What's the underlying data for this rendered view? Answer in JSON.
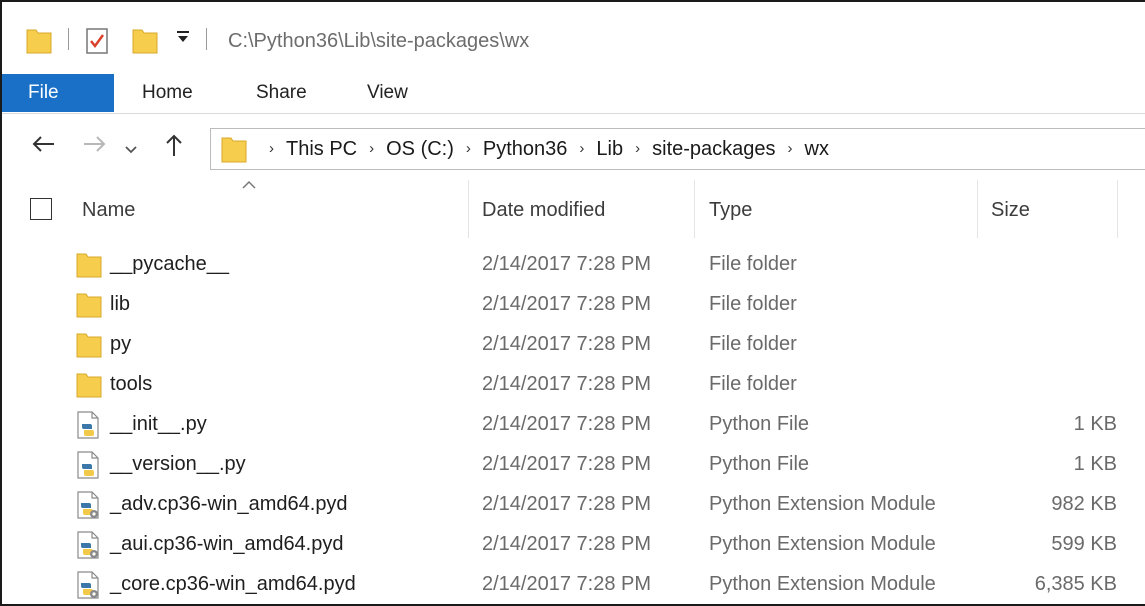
{
  "window": {
    "title_path": "C:\\Python36\\Lib\\site-packages\\wx"
  },
  "ribbon": {
    "tabs": [
      {
        "label": "File",
        "active": true
      },
      {
        "label": "Home",
        "active": false
      },
      {
        "label": "Share",
        "active": false
      },
      {
        "label": "View",
        "active": false
      }
    ]
  },
  "address_bar": {
    "breadcrumbs": [
      "This PC",
      "OS (C:)",
      "Python36",
      "Lib",
      "site-packages",
      "wx"
    ]
  },
  "columns": {
    "name": "Name",
    "date": "Date modified",
    "type": "Type",
    "size": "Size"
  },
  "files": [
    {
      "name": "__pycache__",
      "date": "2/14/2017 7:28 PM",
      "type": "File folder",
      "size": "",
      "icon": "folder-icon"
    },
    {
      "name": "lib",
      "date": "2/14/2017 7:28 PM",
      "type": "File folder",
      "size": "",
      "icon": "folder-icon"
    },
    {
      "name": "py",
      "date": "2/14/2017 7:28 PM",
      "type": "File folder",
      "size": "",
      "icon": "folder-icon"
    },
    {
      "name": "tools",
      "date": "2/14/2017 7:28 PM",
      "type": "File folder",
      "size": "",
      "icon": "folder-icon"
    },
    {
      "name": "__init__.py",
      "date": "2/14/2017 7:28 PM",
      "type": "Python File",
      "size": "1 KB",
      "icon": "python-file-icon"
    },
    {
      "name": "__version__.py",
      "date": "2/14/2017 7:28 PM",
      "type": "Python File",
      "size": "1 KB",
      "icon": "python-file-icon"
    },
    {
      "name": "_adv.cp36-win_amd64.pyd",
      "date": "2/14/2017 7:28 PM",
      "type": "Python Extension Module",
      "size": "982 KB",
      "icon": "python-extension-icon"
    },
    {
      "name": "_aui.cp36-win_amd64.pyd",
      "date": "2/14/2017 7:28 PM",
      "type": "Python Extension Module",
      "size": "599 KB",
      "icon": "python-extension-icon"
    },
    {
      "name": "_core.cp36-win_amd64.pyd",
      "date": "2/14/2017 7:28 PM",
      "type": "Python Extension Module",
      "size": "6,385 KB",
      "icon": "python-extension-icon"
    }
  ],
  "colors": {
    "file_tab": "#1a6fc7",
    "folder": "#f7cd4d"
  }
}
